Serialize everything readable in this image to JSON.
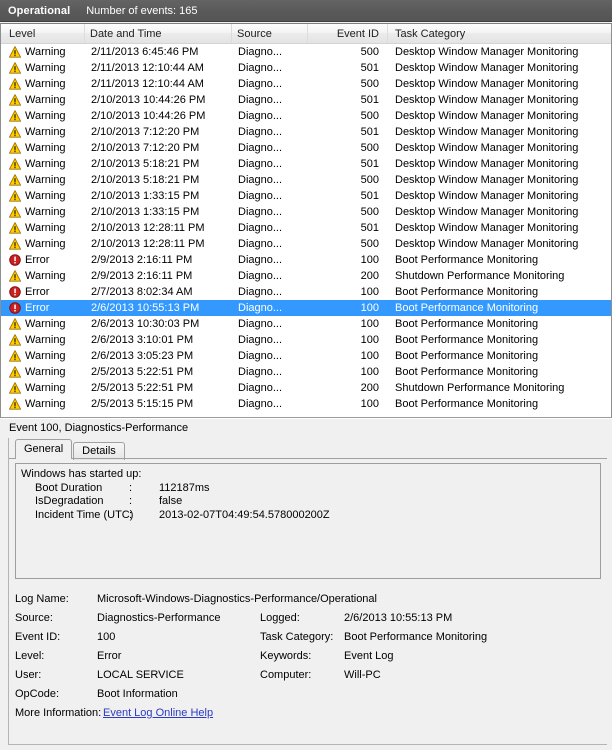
{
  "log_bar": {
    "log_name": "Operational",
    "event_count_label": "Number of events: 165"
  },
  "grid": {
    "columns": [
      {
        "key": "level",
        "label": "Level"
      },
      {
        "key": "datetime",
        "label": "Date and Time"
      },
      {
        "key": "source",
        "label": "Source"
      },
      {
        "key": "event_id",
        "label": "Event ID"
      },
      {
        "key": "task_category",
        "label": "Task Category"
      }
    ],
    "rows": [
      {
        "level": "Warning",
        "icon": "warning-icon",
        "datetime": "2/11/2013 6:45:46 PM",
        "source": "Diagno...",
        "event_id": "500",
        "task_category": "Desktop Window Manager Monitoring",
        "selected": false
      },
      {
        "level": "Warning",
        "icon": "warning-icon",
        "datetime": "2/11/2013 12:10:44 AM",
        "source": "Diagno...",
        "event_id": "501",
        "task_category": "Desktop Window Manager Monitoring",
        "selected": false
      },
      {
        "level": "Warning",
        "icon": "warning-icon",
        "datetime": "2/11/2013 12:10:44 AM",
        "source": "Diagno...",
        "event_id": "500",
        "task_category": "Desktop Window Manager Monitoring",
        "selected": false
      },
      {
        "level": "Warning",
        "icon": "warning-icon",
        "datetime": "2/10/2013 10:44:26 PM",
        "source": "Diagno...",
        "event_id": "501",
        "task_category": "Desktop Window Manager Monitoring",
        "selected": false
      },
      {
        "level": "Warning",
        "icon": "warning-icon",
        "datetime": "2/10/2013 10:44:26 PM",
        "source": "Diagno...",
        "event_id": "500",
        "task_category": "Desktop Window Manager Monitoring",
        "selected": false
      },
      {
        "level": "Warning",
        "icon": "warning-icon",
        "datetime": "2/10/2013 7:12:20 PM",
        "source": "Diagno...",
        "event_id": "501",
        "task_category": "Desktop Window Manager Monitoring",
        "selected": false
      },
      {
        "level": "Warning",
        "icon": "warning-icon",
        "datetime": "2/10/2013 7:12:20 PM",
        "source": "Diagno...",
        "event_id": "500",
        "task_category": "Desktop Window Manager Monitoring",
        "selected": false
      },
      {
        "level": "Warning",
        "icon": "warning-icon",
        "datetime": "2/10/2013 5:18:21 PM",
        "source": "Diagno...",
        "event_id": "501",
        "task_category": "Desktop Window Manager Monitoring",
        "selected": false
      },
      {
        "level": "Warning",
        "icon": "warning-icon",
        "datetime": "2/10/2013 5:18:21 PM",
        "source": "Diagno...",
        "event_id": "500",
        "task_category": "Desktop Window Manager Monitoring",
        "selected": false
      },
      {
        "level": "Warning",
        "icon": "warning-icon",
        "datetime": "2/10/2013 1:33:15 PM",
        "source": "Diagno...",
        "event_id": "501",
        "task_category": "Desktop Window Manager Monitoring",
        "selected": false
      },
      {
        "level": "Warning",
        "icon": "warning-icon",
        "datetime": "2/10/2013 1:33:15 PM",
        "source": "Diagno...",
        "event_id": "500",
        "task_category": "Desktop Window Manager Monitoring",
        "selected": false
      },
      {
        "level": "Warning",
        "icon": "warning-icon",
        "datetime": "2/10/2013 12:28:11 PM",
        "source": "Diagno...",
        "event_id": "501",
        "task_category": "Desktop Window Manager Monitoring",
        "selected": false
      },
      {
        "level": "Warning",
        "icon": "warning-icon",
        "datetime": "2/10/2013 12:28:11 PM",
        "source": "Diagno...",
        "event_id": "500",
        "task_category": "Desktop Window Manager Monitoring",
        "selected": false
      },
      {
        "level": "Error",
        "icon": "error-icon",
        "datetime": "2/9/2013 2:16:11 PM",
        "source": "Diagno...",
        "event_id": "100",
        "task_category": "Boot Performance Monitoring",
        "selected": false
      },
      {
        "level": "Warning",
        "icon": "warning-icon",
        "datetime": "2/9/2013 2:16:11 PM",
        "source": "Diagno...",
        "event_id": "200",
        "task_category": "Shutdown Performance Monitoring",
        "selected": false
      },
      {
        "level": "Error",
        "icon": "error-icon",
        "datetime": "2/7/2013 8:02:34 AM",
        "source": "Diagno...",
        "event_id": "100",
        "task_category": "Boot Performance Monitoring",
        "selected": false
      },
      {
        "level": "Error",
        "icon": "error-icon",
        "datetime": "2/6/2013 10:55:13 PM",
        "source": "Diagno...",
        "event_id": "100",
        "task_category": "Boot Performance Monitoring",
        "selected": true
      },
      {
        "level": "Warning",
        "icon": "warning-icon",
        "datetime": "2/6/2013 10:30:03 PM",
        "source": "Diagno...",
        "event_id": "100",
        "task_category": "Boot Performance Monitoring",
        "selected": false
      },
      {
        "level": "Warning",
        "icon": "warning-icon",
        "datetime": "2/6/2013 3:10:01 PM",
        "source": "Diagno...",
        "event_id": "100",
        "task_category": "Boot Performance Monitoring",
        "selected": false
      },
      {
        "level": "Warning",
        "icon": "warning-icon",
        "datetime": "2/6/2013 3:05:23 PM",
        "source": "Diagno...",
        "event_id": "100",
        "task_category": "Boot Performance Monitoring",
        "selected": false
      },
      {
        "level": "Warning",
        "icon": "warning-icon",
        "datetime": "2/5/2013 5:22:51 PM",
        "source": "Diagno...",
        "event_id": "100",
        "task_category": "Boot Performance Monitoring",
        "selected": false
      },
      {
        "level": "Warning",
        "icon": "warning-icon",
        "datetime": "2/5/2013 5:22:51 PM",
        "source": "Diagno...",
        "event_id": "200",
        "task_category": "Shutdown Performance Monitoring",
        "selected": false
      },
      {
        "level": "Warning",
        "icon": "warning-icon",
        "datetime": "2/5/2013 5:15:15 PM",
        "source": "Diagno...",
        "event_id": "100",
        "task_category": "Boot Performance Monitoring",
        "selected": false
      }
    ]
  },
  "detail": {
    "title": "Event 100, Diagnostics-Performance",
    "tabs": [
      {
        "label": "General",
        "active": true
      },
      {
        "label": "Details",
        "active": false
      }
    ],
    "message": {
      "headline": "Windows has started up:",
      "entries": [
        {
          "key": "Boot Duration",
          "sep": ":",
          "value": "112187ms"
        },
        {
          "key": "IsDegradation",
          "sep": ":",
          "value": "false"
        },
        {
          "key": "Incident Time (UTC)",
          "sep": ":",
          "value": "2013-02-07T04:49:54.578000200Z"
        }
      ]
    },
    "meta": {
      "log_name_label": "Log Name:",
      "log_name_value": "Microsoft-Windows-Diagnostics-Performance/Operational",
      "source_label": "Source:",
      "source_value": "Diagnostics-Performance",
      "logged_label": "Logged:",
      "logged_value": "2/6/2013 10:55:13 PM",
      "event_id_label": "Event ID:",
      "event_id_value": "100",
      "task_category_label": "Task Category:",
      "task_category_value": "Boot Performance Monitoring",
      "level_label": "Level:",
      "level_value": "Error",
      "keywords_label": "Keywords:",
      "keywords_value": "Event Log",
      "user_label": "User:",
      "user_value": "LOCAL SERVICE",
      "computer_label": "Computer:",
      "computer_value": "Will-PC",
      "opcode_label": "OpCode:",
      "opcode_value": "Boot Information",
      "more_info_label": "More Information:",
      "more_info_link": "Event Log Online Help"
    }
  },
  "colors": {
    "selection_blue": "#3399ff",
    "warning_yellow": "#ffc000",
    "error_red": "#cc2222",
    "link_blue": "#2b3bc4",
    "log_bar_gray": "#5b5b5b"
  }
}
